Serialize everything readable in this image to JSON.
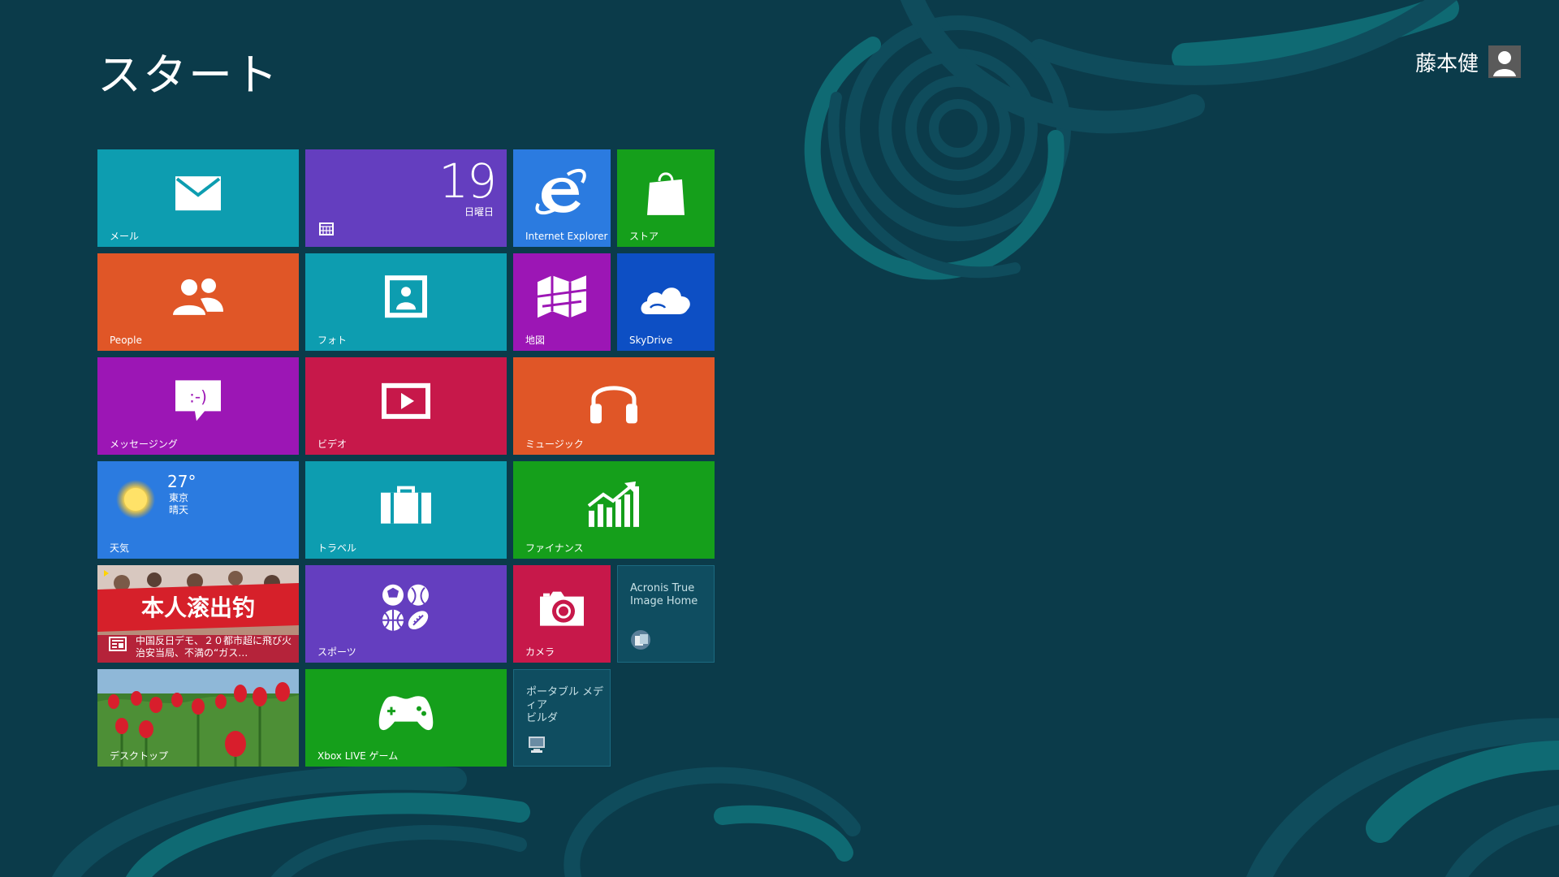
{
  "screen": {
    "title": "スタート",
    "user_name": "藤本健",
    "accent_background": "#0b3b4a"
  },
  "tiles": {
    "mail": {
      "label": "メール",
      "color": "#0d9db0",
      "icon": "mail-icon"
    },
    "calendar": {
      "label": "",
      "date": "19",
      "weekday": "日曜日",
      "color": "#643ebf",
      "icon": "calendar-icon"
    },
    "ie": {
      "label": "Internet Explorer",
      "color": "#2b7be0",
      "icon": "internet-explorer-icon"
    },
    "store": {
      "label": "ストア",
      "color": "#159f1b",
      "icon": "store-bag-icon"
    },
    "people": {
      "label": "People",
      "color": "#e05627",
      "icon": "people-icon"
    },
    "photos": {
      "label": "フォト",
      "color": "#0d9db0",
      "icon": "photo-icon"
    },
    "maps": {
      "label": "地図",
      "color": "#9c16b5",
      "icon": "map-icon"
    },
    "skydrive": {
      "label": "SkyDrive",
      "color": "#0d4fc4",
      "icon": "cloud-icon"
    },
    "messaging": {
      "label": "メッセージング",
      "color": "#9c16b5",
      "icon": "chat-bubble-icon",
      "glyph": ":-)"
    },
    "video": {
      "label": "ビデオ",
      "color": "#c7184a",
      "icon": "video-play-icon"
    },
    "music": {
      "label": "ミュージック",
      "color": "#e05627",
      "icon": "headphones-icon"
    },
    "weather": {
      "label": "天気",
      "temp": "27°",
      "city": "東京",
      "condition": "晴天",
      "color": "#2b7be0",
      "icon": "sun-icon"
    },
    "travel": {
      "label": "トラベル",
      "color": "#0d9db0",
      "icon": "suitcase-icon"
    },
    "finance": {
      "label": "ファイナンス",
      "color": "#159f1b",
      "icon": "finance-chart-icon"
    },
    "news": {
      "headline": "中国反日デモ、２０都市超に飛び火 治安当局、不満の“ガス…",
      "icon": "news-icon"
    },
    "sports": {
      "label": "スポーツ",
      "color": "#643ebf",
      "icon": "sports-balls-icon"
    },
    "camera": {
      "label": "カメラ",
      "color": "#c7184a",
      "icon": "camera-icon"
    },
    "acronis": {
      "label": "Acronis True\nImage Home",
      "color": "#0f4d60",
      "icon": "acronis-app-icon"
    },
    "desktop": {
      "label": "デスクトップ",
      "icon": "desktop-tulips-image"
    },
    "xbox": {
      "label": "Xbox LIVE ゲーム",
      "color": "#159f1b",
      "icon": "game-controller-icon"
    },
    "media_builder": {
      "label": "ポータブル メディア\nビルダ",
      "color": "#0f4d60",
      "icon": "media-builder-app-icon"
    }
  }
}
